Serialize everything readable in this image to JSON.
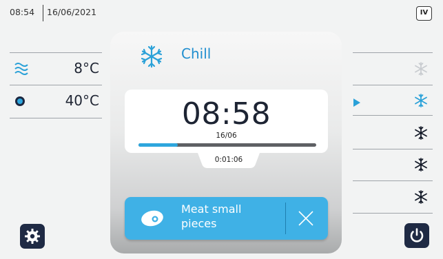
{
  "header": {
    "time": "08:54",
    "date": "16/06/2021",
    "mode_badge": "IV"
  },
  "left_panel": {
    "rows": [
      {
        "icon": "air-wave-icon",
        "value": "8°C"
      },
      {
        "icon": "probe-icon",
        "value": "40°C"
      }
    ]
  },
  "cycle": {
    "mode_icon": "snowflake-icon",
    "mode_label": "Chill",
    "remaining": "08:58",
    "end_date": "16/06",
    "progress_fraction": 0.22,
    "elapsed": "0:01:06",
    "program": {
      "icon": "meat-icon",
      "label": "Meat small pieces",
      "close_icon": "close-icon"
    }
  },
  "right_panel": {
    "steps": [
      {
        "icon": "snowflake-icon",
        "state": "disabled"
      },
      {
        "icon": "snowflake-icon",
        "state": "current"
      },
      {
        "icon": "snowflake-icon",
        "state": "normal"
      },
      {
        "icon": "snowflake-icon",
        "state": "normal"
      },
      {
        "icon": "snowflake-icon",
        "state": "normal"
      }
    ]
  },
  "buttons": {
    "settings_icon": "gear-icon",
    "power_icon": "power-icon"
  },
  "colors": {
    "accent": "#2ea6dd",
    "program_button": "#3fb1e6",
    "dark_button": "#1f2a44",
    "text": "#1f2533"
  }
}
